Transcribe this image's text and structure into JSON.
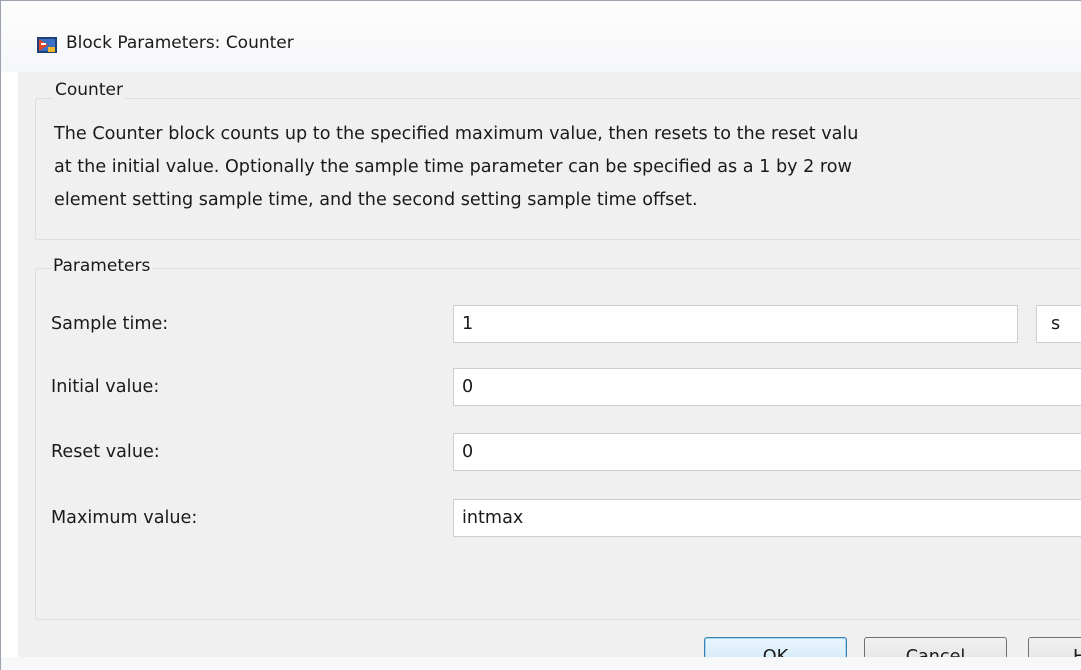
{
  "window": {
    "title": "Block Parameters: Counter"
  },
  "description": {
    "legend": "Counter",
    "lines": [
      "The Counter block counts up to the specified maximum value, then resets to the reset valu",
      "at the initial value. Optionally the sample time parameter can be specified as a 1 by 2 row",
      "element setting sample time, and the second setting sample time offset."
    ]
  },
  "parameters": {
    "legend": "Parameters",
    "sample_time": {
      "label": "Sample time:",
      "value": "1",
      "unit": "s"
    },
    "initial_value": {
      "label": "Initial value:",
      "value": "0"
    },
    "reset_value": {
      "label": "Reset value:",
      "value": "0"
    },
    "maximum_value": {
      "label": "Maximum value:",
      "value": "intmax"
    }
  },
  "buttons": {
    "ok": "OK",
    "cancel": "Cancel",
    "help": "H"
  }
}
